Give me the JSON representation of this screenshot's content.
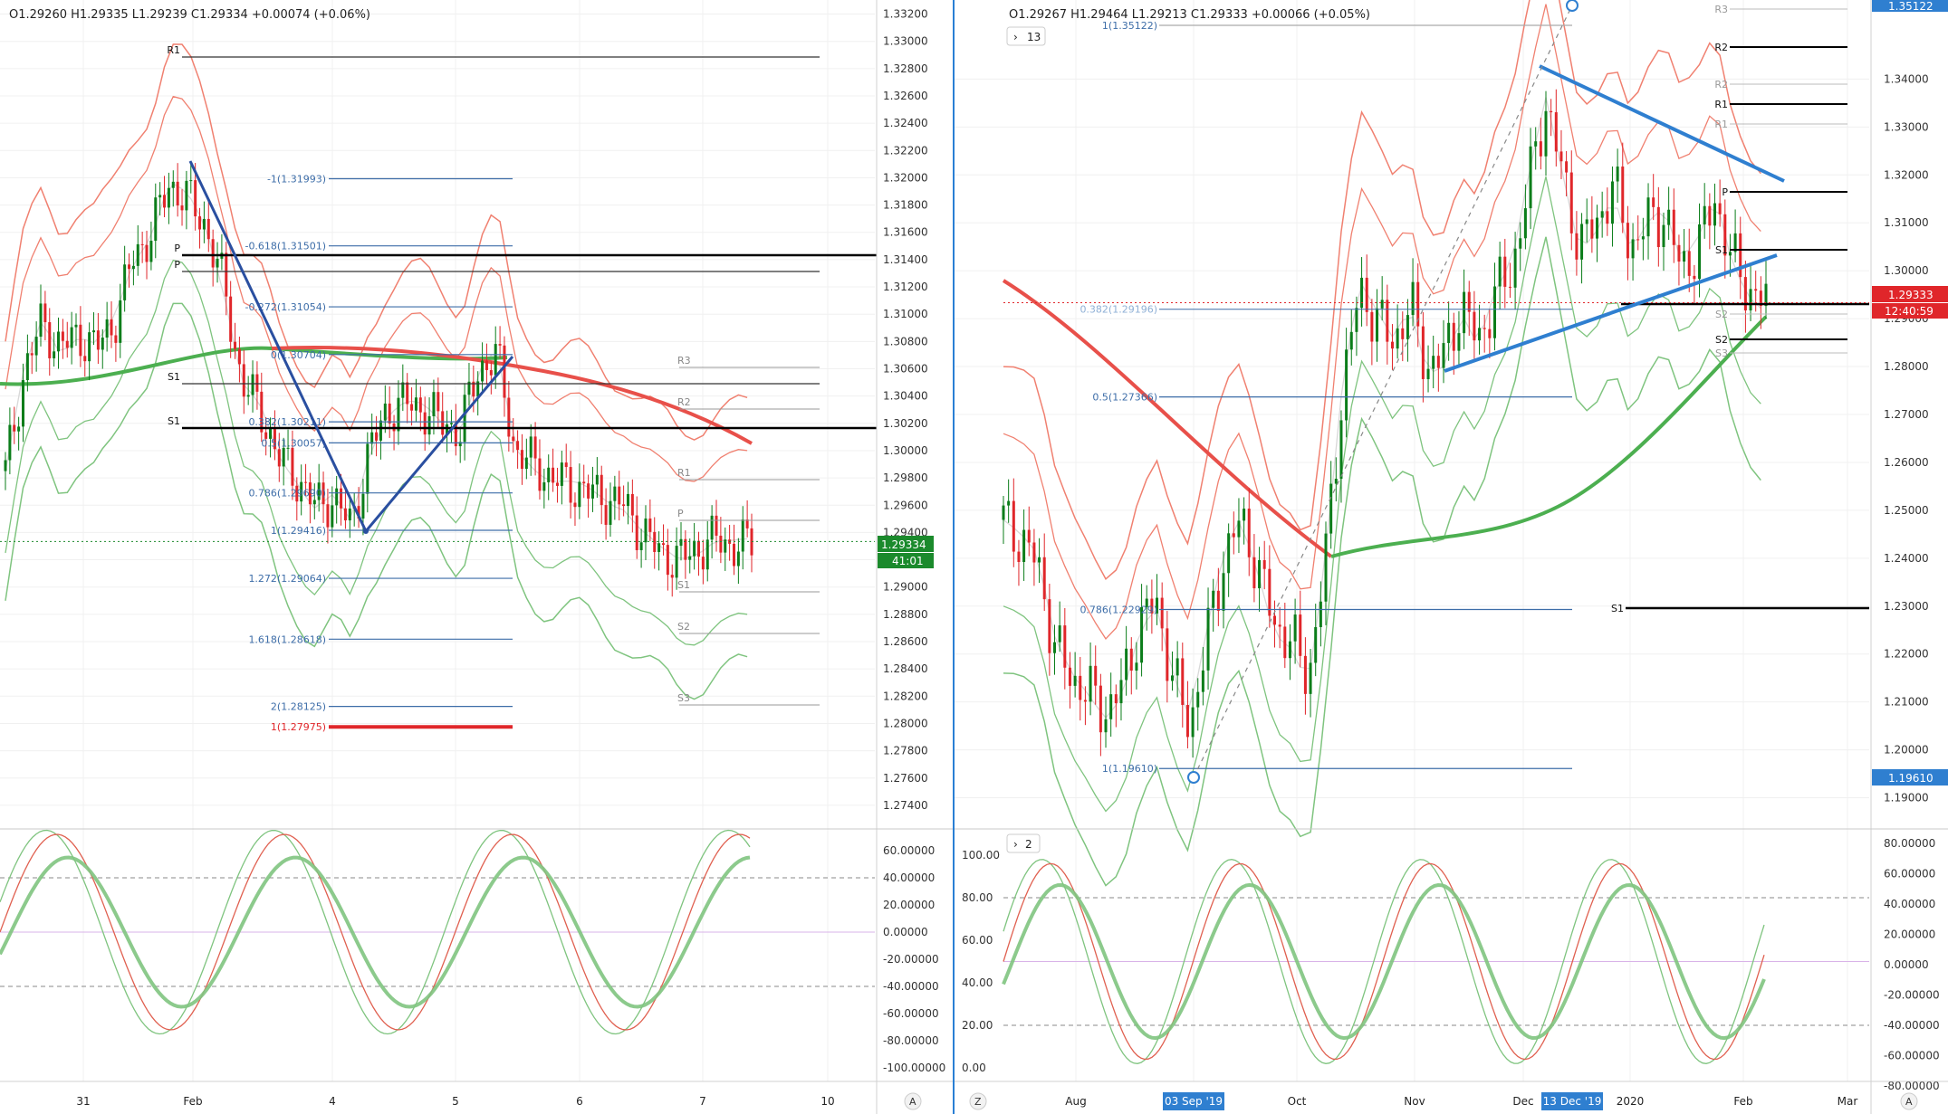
{
  "colors": {
    "background": "#ffffff",
    "bull": "#0b7d1a",
    "bear": "#e0262a",
    "grid": "#f0f0f0",
    "divider": "#2a7fd4",
    "red_band": "#f08070",
    "green_band": "#7fc47f",
    "ma_red": "#e8504a",
    "ma_green": "#4caf50",
    "trend_blue": "#2f7fd0",
    "fib_blue": "#3d6da8",
    "price_tag_green": "#1b8a2c",
    "price_tag_red": "#e0262a",
    "price_tag_blue": "#2f7fd0"
  },
  "left": {
    "ohlc": "O1.29260  H1.29335  L1.29239  C1.29334  +0.00074 (+0.06%)",
    "price_tag": "1.29334",
    "countdown": "41:01",
    "time_labels": [
      "31",
      "Feb",
      "4",
      "5",
      "6",
      "7",
      "10"
    ],
    "scale_button": "A",
    "pivot_labels": [
      "R1",
      "P",
      "P",
      "S1",
      "S1",
      "R3",
      "R2",
      "R1",
      "P",
      "S1",
      "S2",
      "S3"
    ],
    "fib_labels": [
      "-1(1.31993)",
      "-0.618(1.31501)",
      "-0.272(1.31054)",
      "0(1.30704)",
      "0.382(1.30211)",
      "0.5(1.30057)",
      "0.786(1.29690)",
      "1(1.29416)",
      "1.272(1.29064)",
      "1.618(1.28618)",
      "2(1.28125)",
      "1(1.27975)"
    ],
    "oscillator_ticks": [
      "60.00000",
      "40.00000",
      "20.00000",
      "0.00000",
      "-20.00000",
      "-40.00000",
      "-60.00000",
      "-80.00000",
      "-100.00000"
    ]
  },
  "right": {
    "ohlc": "O1.29267  H1.29464  L1.29213  C1.29333  +0.00066 (+0.05%)",
    "indicator_badge": "13",
    "osc_badge": "2",
    "price_top": "1.35122",
    "price_tag": "1.29333",
    "countdown": "12:40:59",
    "price_low_tag": "1.19610",
    "time_labels": [
      "Aug",
      "03 Sep '19",
      "Oct",
      "Nov",
      "Dec",
      "13 Dec '19",
      "2020",
      "Feb",
      "Mar"
    ],
    "z_button": "Z",
    "scale_button": "A",
    "pivot_labels": [
      "R3",
      "R2",
      "R2",
      "R1",
      "R1",
      "P",
      "S1",
      "S2",
      "S2",
      "S3",
      "S1"
    ],
    "fib_labels": [
      "1(1.35122)",
      "0.382(1.29196)",
      "0.5(1.27366)",
      "0.786(1.22929)",
      "1(1.19610)"
    ],
    "osc_left_ticks": [
      "100.00",
      "80.00",
      "60.00",
      "40.00",
      "20.00",
      "0.00"
    ],
    "osc_right_ticks": [
      "80.00000",
      "60.00000",
      "40.00000",
      "20.00000",
      "0.00000",
      "-20.00000",
      "-40.00000",
      "-60.00000",
      "-80.00000"
    ]
  },
  "chart_data": [
    {
      "type": "candlestick",
      "panel": "left",
      "ylim": [
        1.2728,
        1.3325
      ],
      "y_ticks": [
        "1.33200",
        "1.33000",
        "1.32800",
        "1.32600",
        "1.32400",
        "1.32200",
        "1.32000",
        "1.31800",
        "1.31600",
        "1.31400",
        "1.31200",
        "1.31000",
        "1.30800",
        "1.30600",
        "1.30400",
        "1.30200",
        "1.30000",
        "1.29800",
        "1.29600",
        "1.29400",
        "1.29200",
        "1.29000",
        "1.28800",
        "1.28600",
        "1.28400",
        "1.28200",
        "1.28000",
        "1.27800",
        "1.27600",
        "1.27400"
      ],
      "fib_levels": [
        1.31993,
        1.31501,
        1.31054,
        1.30704,
        1.30211,
        1.30057,
        1.2969,
        1.29416,
        1.29064,
        1.28618,
        1.28125,
        1.27975
      ],
      "close_path": [
        1.2985,
        1.3055,
        1.3095,
        1.3075,
        1.3085,
        1.3075,
        1.3095,
        1.314,
        1.316,
        1.3195,
        1.3185,
        1.3165,
        1.312,
        1.305,
        1.303,
        1.2995,
        1.298,
        1.296,
        1.2965,
        1.2945,
        1.3,
        1.303,
        1.3035,
        1.303,
        1.302,
        1.3015,
        1.306,
        1.307,
        1.3,
        1.299,
        1.298,
        1.2975,
        1.297,
        1.2965,
        1.296,
        1.294,
        1.2925,
        1.292,
        1.2928,
        1.2935,
        1.293,
        1.2933
      ]
    },
    {
      "type": "candlestick",
      "panel": "right",
      "ylim": [
        1.185,
        1.355
      ],
      "y_ticks": [
        "1.34000",
        "1.33000",
        "1.32000",
        "1.31000",
        "1.30000",
        "1.29000",
        "1.28000",
        "1.27000",
        "1.26000",
        "1.25000",
        "1.24000",
        "1.23000",
        "1.22000",
        "1.21000",
        "1.20000",
        "1.19000"
      ],
      "fib_levels": [
        1.35122,
        1.29196,
        1.27366,
        1.22929,
        1.1961
      ],
      "close_path": [
        1.248,
        1.244,
        1.239,
        1.222,
        1.215,
        1.212,
        1.208,
        1.213,
        1.226,
        1.231,
        1.215,
        1.205,
        1.223,
        1.24,
        1.248,
        1.238,
        1.226,
        1.223,
        1.215,
        1.24,
        1.275,
        1.296,
        1.29,
        1.285,
        1.293,
        1.28,
        1.282,
        1.293,
        1.285,
        1.295,
        1.3,
        1.318,
        1.335,
        1.32,
        1.305,
        1.31,
        1.318,
        1.305,
        1.31,
        1.312,
        1.3,
        1.305,
        1.315,
        1.302,
        1.296,
        1.2933
      ]
    }
  ]
}
